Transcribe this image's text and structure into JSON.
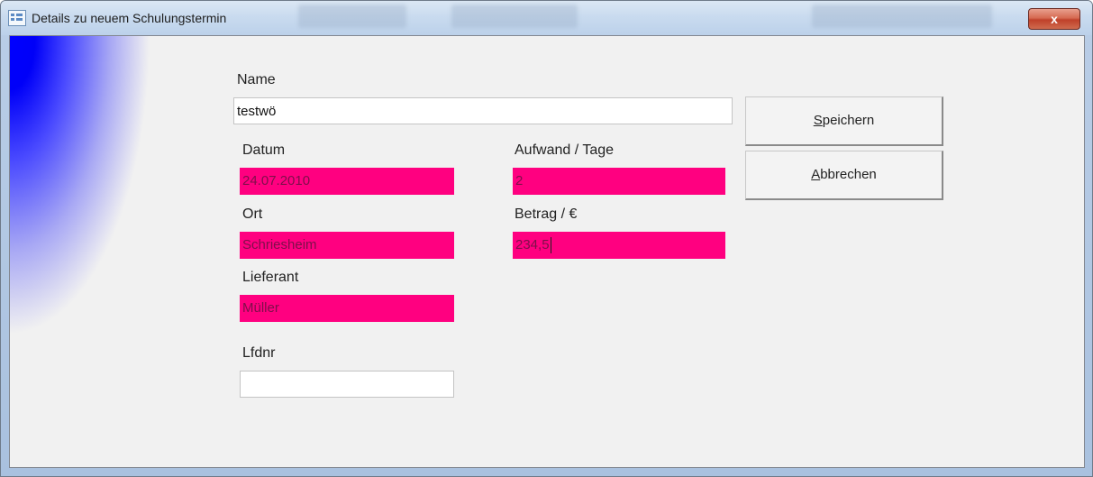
{
  "window": {
    "title": "Details zu neuem Schulungstermin",
    "close_label": "x"
  },
  "form": {
    "name": {
      "label": "Name",
      "value": "testwö"
    },
    "datum": {
      "label": "Datum",
      "value": "24.07.2010"
    },
    "aufwand": {
      "label": "Aufwand / Tage",
      "value": "2"
    },
    "ort": {
      "label": "Ort",
      "value": "Schriesheim"
    },
    "betrag": {
      "label": "Betrag / €",
      "value": "234,5"
    },
    "lieferant": {
      "label": "Lieferant",
      "value": "Müller"
    },
    "lfdnr": {
      "label": "Lfdnr",
      "value": ""
    }
  },
  "buttons": {
    "save": {
      "accel": "S",
      "rest": "peichern"
    },
    "cancel": {
      "accel": "A",
      "rest": "bbrechen"
    }
  },
  "colors": {
    "highlight_field": "#ff0080",
    "gradient": "#0000ff"
  }
}
